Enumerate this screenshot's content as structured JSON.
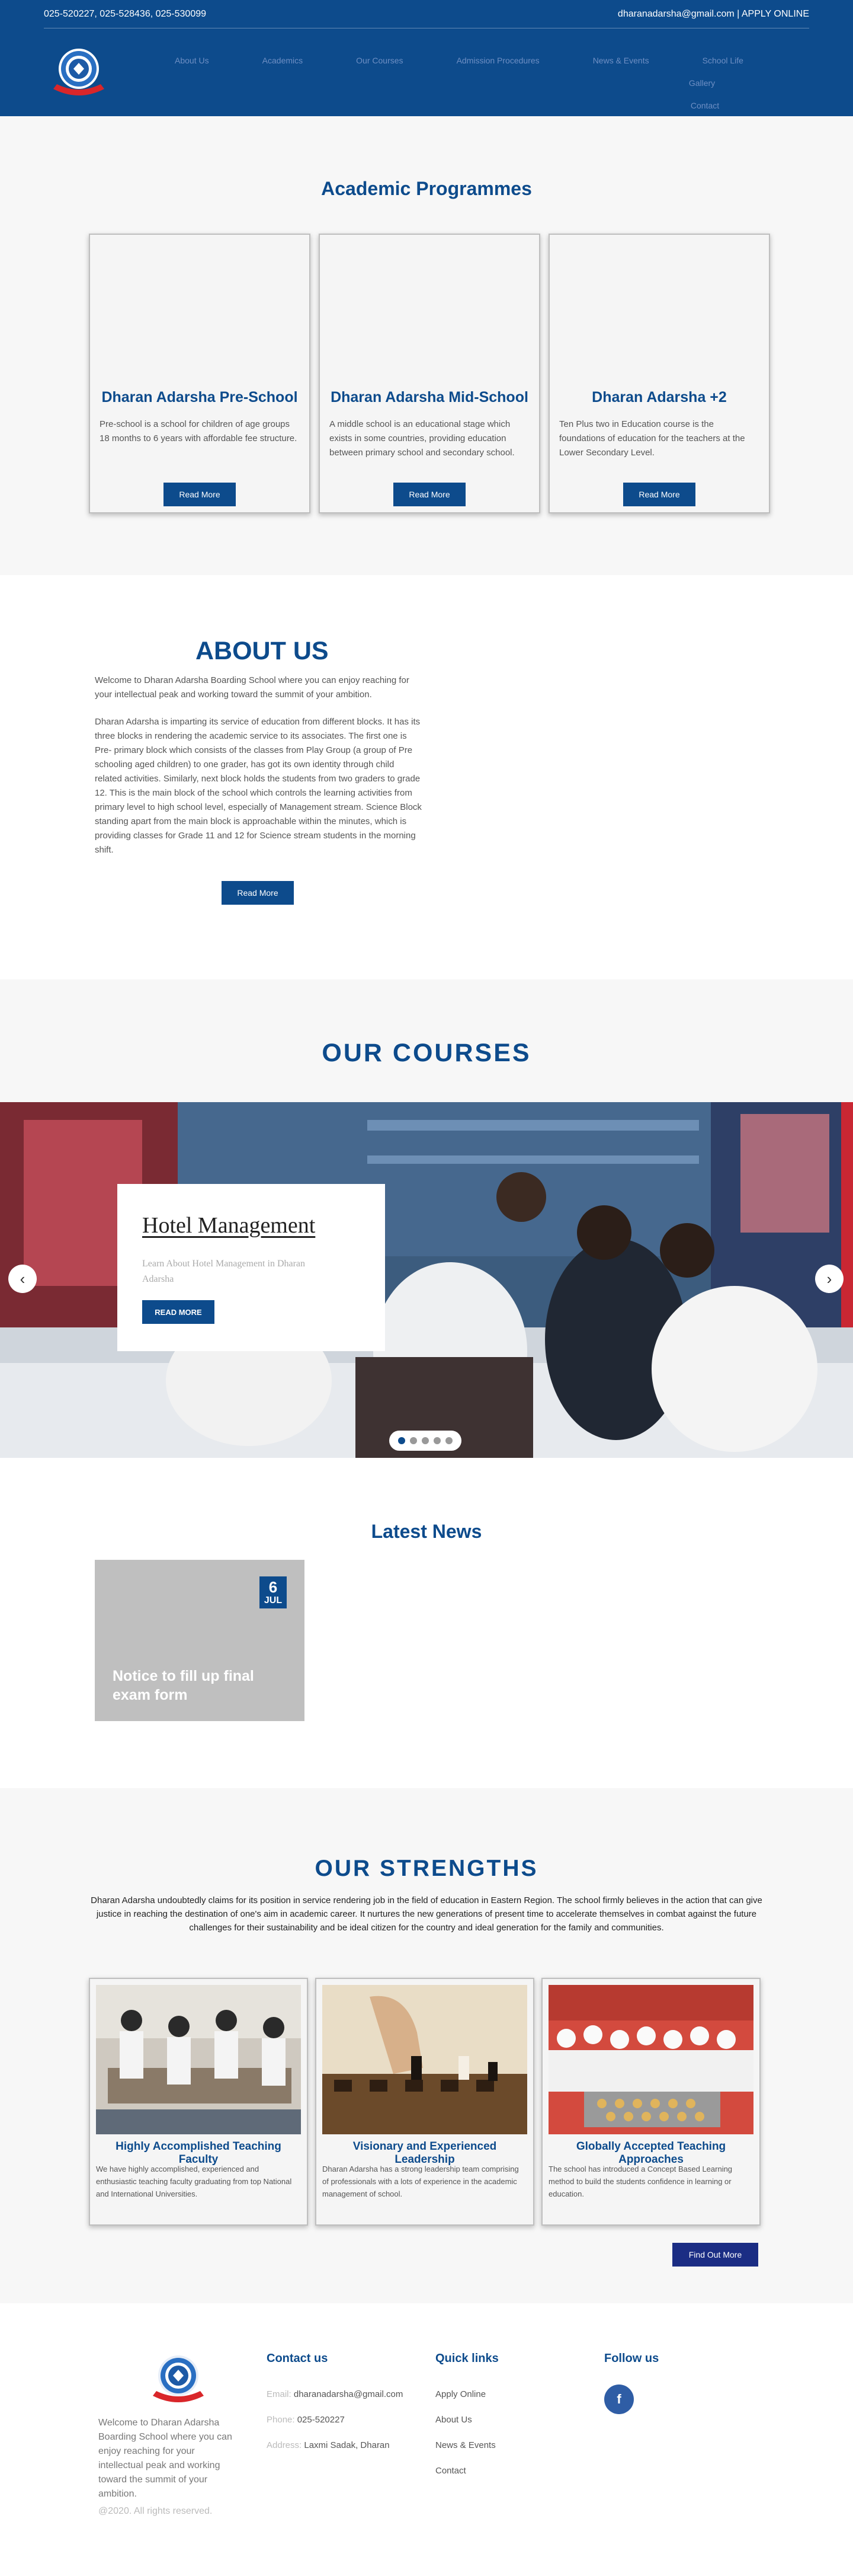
{
  "topbar": {
    "phones": "025-520227, 025-528436, 025-530099",
    "email_apply": "dharanadarsha@gmail.com | APPLY ONLINE"
  },
  "nav": {
    "items": [
      "About Us",
      "Academics",
      "Our Courses",
      "Admission Procedures",
      "News & Events",
      "School Life",
      "Gallery",
      "Contact"
    ]
  },
  "academic": {
    "title": "Academic Programmes",
    "cards": [
      {
        "title": "Dharan Adarsha Pre-School",
        "text": "Pre-school is a school for children of age groups 18 months to 6 years with affordable fee structure.",
        "button": "Read More"
      },
      {
        "title": "Dharan Adarsha Mid-School",
        "text": "A middle school is an educational stage which exists in some countries, providing education between primary school and secondary school.",
        "button": "Read More"
      },
      {
        "title": "Dharan Adarsha +2",
        "text": "Ten Plus two in Education course is the foundations of education for the teachers at the Lower Secondary Level.",
        "button": "Read More"
      }
    ]
  },
  "about": {
    "title": "ABOUT US",
    "intro": "Welcome to Dharan Adarsha Boarding School where you can enjoy reaching for your intellectual peak and working toward the summit of your ambition.",
    "body": "Dharan Adarsha is imparting its service of education from different blocks. It has its three blocks in rendering the academic service to its associates. The first one is Pre- primary block which consists of the classes from Play Group (a group of Pre schooling aged children) to one grader, has got its own identity through child related activities. Similarly, next block holds the students from two graders to grade 12. This is the main block of the school which controls the learning activities from primary level to high school level, especially of Management stream. Science Block standing apart from the main block is approachable within the minutes, which is providing classes for Grade 11 and 12 for Science stream students in the morning shift.",
    "button": "Read More"
  },
  "courses": {
    "title": "OUR COURSES",
    "slide_title": "Hotel Management",
    "slide_text": "Learn About Hotel Management in Dharan Adarsha",
    "slide_button": "READ MORE",
    "prev": "‹",
    "next": "›",
    "dot_count": 5,
    "active_dot": 1
  },
  "news": {
    "title": "Latest News",
    "items": [
      {
        "day": "6",
        "month": "JUL",
        "title": "Notice to fill up final exam form"
      }
    ]
  },
  "strengths": {
    "title": "OUR STRENGTHS",
    "intro": "Dharan Adarsha undoubtedly claims for its position in service rendering job in the field of education in Eastern Region. The school firmly believes in the action that can give justice in reaching the destination of one's aim in academic career. It nurtures the new generations of present time to accelerate themselves in combat against the future challenges for their sustainability and be ideal citizen for the country and ideal generation for the family and communities.",
    "cards": [
      {
        "title": "Highly Accomplished Teaching Faculty",
        "text": "We have highly accomplished, experienced and enthusiastic teaching faculty graduating from top National and International Universities."
      },
      {
        "title": "Visionary and Experienced Leadership",
        "text": "Dharan Adarsha has a strong leadership team comprising of professionals with a lots of experience in the academic management of school."
      },
      {
        "title": "Globally Accepted Teaching Approaches",
        "text": "The school has introduced a Concept Based Learning method to build the students confidence in learning or education."
      }
    ],
    "button": "Find Out More"
  },
  "footer": {
    "about": "Welcome to Dharan Adarsha Boarding School where you can enjoy reaching for your intellectual peak and working toward the summit of your ambition.",
    "copyright": "@2020. All rights reserved.",
    "contact_title": "Contact us",
    "email_label": "Email:",
    "email": "dharanadarsha@gmail.com",
    "phone_label": "Phone:",
    "phone": "025-520227",
    "address_label": "Address:",
    "address": "Laxmi Sadak, Dharan",
    "links_title": "Quick links",
    "links": [
      "Apply Online",
      "About Us",
      "News & Events",
      "Contact"
    ],
    "follow_title": "Follow us",
    "facebook_icon": "f"
  },
  "colors": {
    "primary": "#0d4b8c",
    "nav_link": "#6e8fc4",
    "find_button": "#1b2d84"
  }
}
